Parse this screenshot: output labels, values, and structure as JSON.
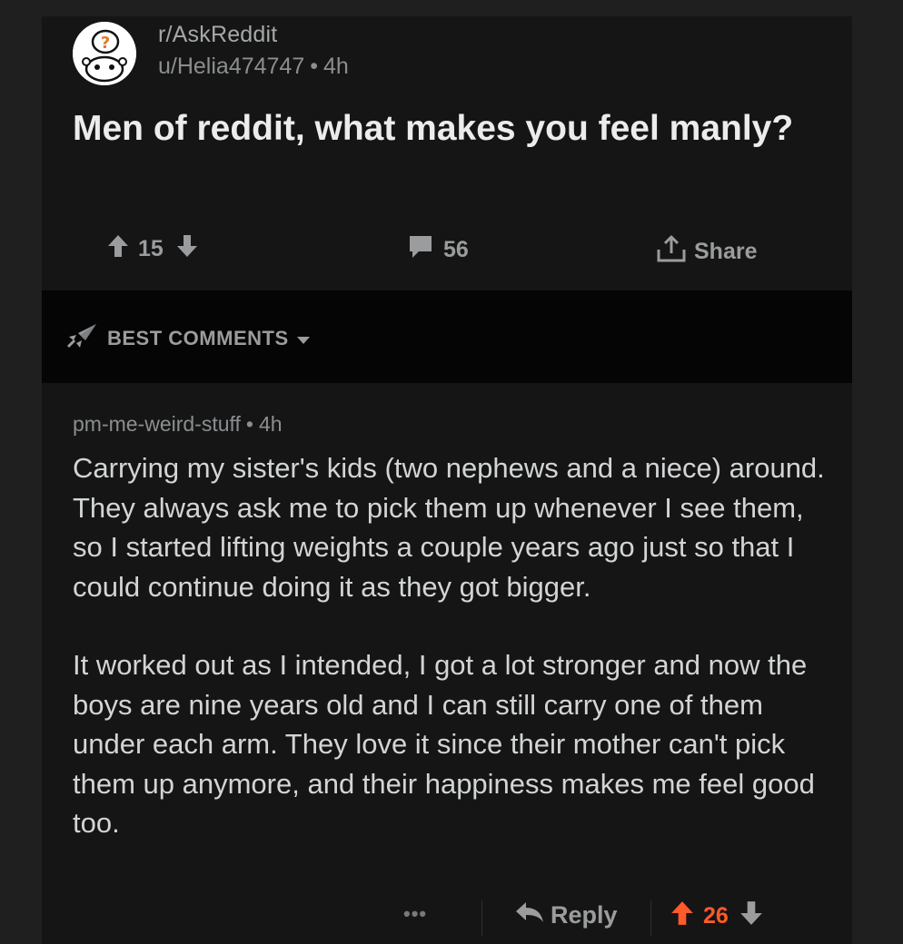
{
  "post": {
    "subreddit": "r/AskReddit",
    "author": "u/Helia474747",
    "separator": "•",
    "age": "4h",
    "title": "Men of reddit, what makes you feel manly?",
    "score": "15",
    "comment_count": "56",
    "share_label": "Share"
  },
  "sort": {
    "label": "BEST COMMENTS"
  },
  "comment": {
    "author": "pm-me-weird-stuff",
    "separator": "•",
    "age": "4h",
    "paragraphs": [
      "Carrying my sister's kids (two nephews and a niece) around. They always ask me to pick them up whenever I see them, so I started lifting weights a couple years ago just so that I could continue doing it as they got bigger.",
      "It worked out as I intended, I got a lot stronger and now the boys are nine years old and I can still carry one of them under each arm. They love it since their mother can't pick them up anymore, and their happiness makes me feel good too."
    ],
    "more_label": "•••",
    "reply_label": "Reply",
    "score": "26"
  },
  "colors": {
    "background": "#1f1f1f",
    "card": "#151515",
    "sort_bar": "#050505",
    "muted_text": "#9a9c9e",
    "body_text": "#d2d4d5",
    "upvoted": "#ff5a2a"
  },
  "icons": {
    "subreddit": "question-snoo-icon",
    "upvote": "arrow-up-icon",
    "downvote": "arrow-down-icon",
    "comments": "speech-bubble-icon",
    "share": "share-icon",
    "sort": "rocket-icon",
    "dropdown": "caret-down-icon",
    "reply": "reply-arrow-icon"
  }
}
